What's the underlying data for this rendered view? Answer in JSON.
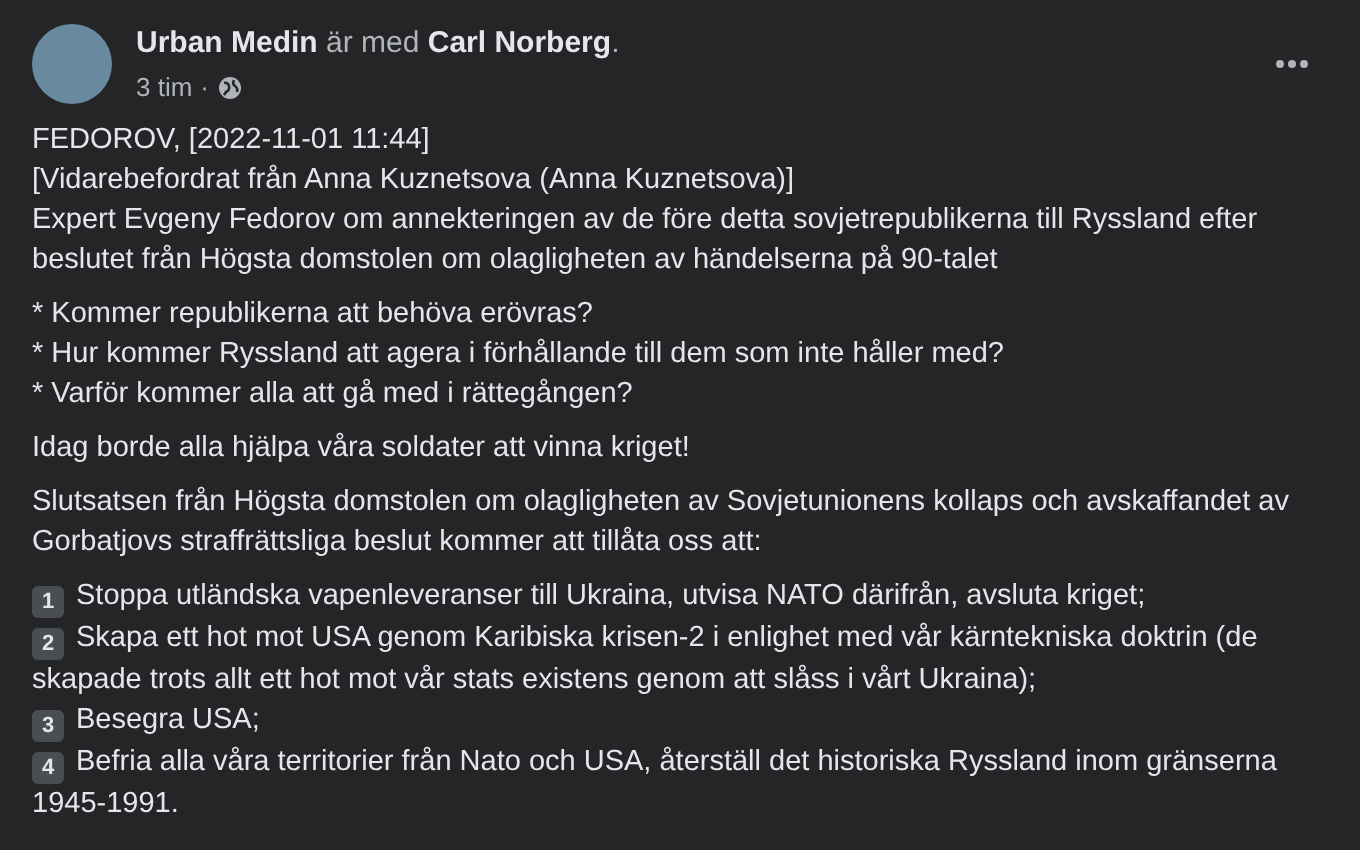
{
  "post": {
    "author": "Urban Medin",
    "connector": "är med",
    "tagged": "Carl Norberg",
    "period": ".",
    "time": "3 tim",
    "separator": "·"
  },
  "body": [
    {
      "kind": "lines",
      "lines": [
        "FEDOROV, [2022-11-01 11:44]",
        "[Vidarebefordrat från Anna Kuznetsova (Anna Kuznetsova)]",
        "Expert Evgeny Fedorov om annekteringen av de före detta sovjetrepublikerna till Ryssland efter beslutet från Högsta domstolen om olagligheten av händelserna på 90-talet"
      ]
    },
    {
      "kind": "lines",
      "lines": [
        "* Kommer republikerna att behöva erövras?",
        "* Hur kommer Ryssland att agera i förhållande till dem som inte håller med?",
        "* Varför kommer alla att gå med i rättegången?"
      ]
    },
    {
      "kind": "lines",
      "lines": [
        "Idag borde alla hjälpa våra soldater att vinna kriget!"
      ]
    },
    {
      "kind": "lines",
      "lines": [
        "Slutsatsen från Högsta domstolen om olagligheten av Sovjetunionens kollaps och avskaffandet av Gorbatjovs straffrättsliga beslut kommer att tillåta oss att:"
      ]
    },
    {
      "kind": "numbered",
      "items": [
        {
          "marker": "1",
          "text": "Stoppa utländska vapenleveranser till Ukraina, utvisa NATO därifrån, avsluta kriget;"
        },
        {
          "marker": "2",
          "text": "Skapa ett hot mot USA genom Karibiska krisen-2 i enlighet med vår kärntekniska doktrin (de skapade trots allt ett hot mot vår stats existens genom att slåss i vårt Ukraina);"
        },
        {
          "marker": "3",
          "text": "Besegra USA;"
        },
        {
          "marker": "4",
          "text": "Befria alla våra territorier från Nato och USA, återställ det historiska Ryssland inom gränserna 1945-1991."
        }
      ]
    }
  ]
}
